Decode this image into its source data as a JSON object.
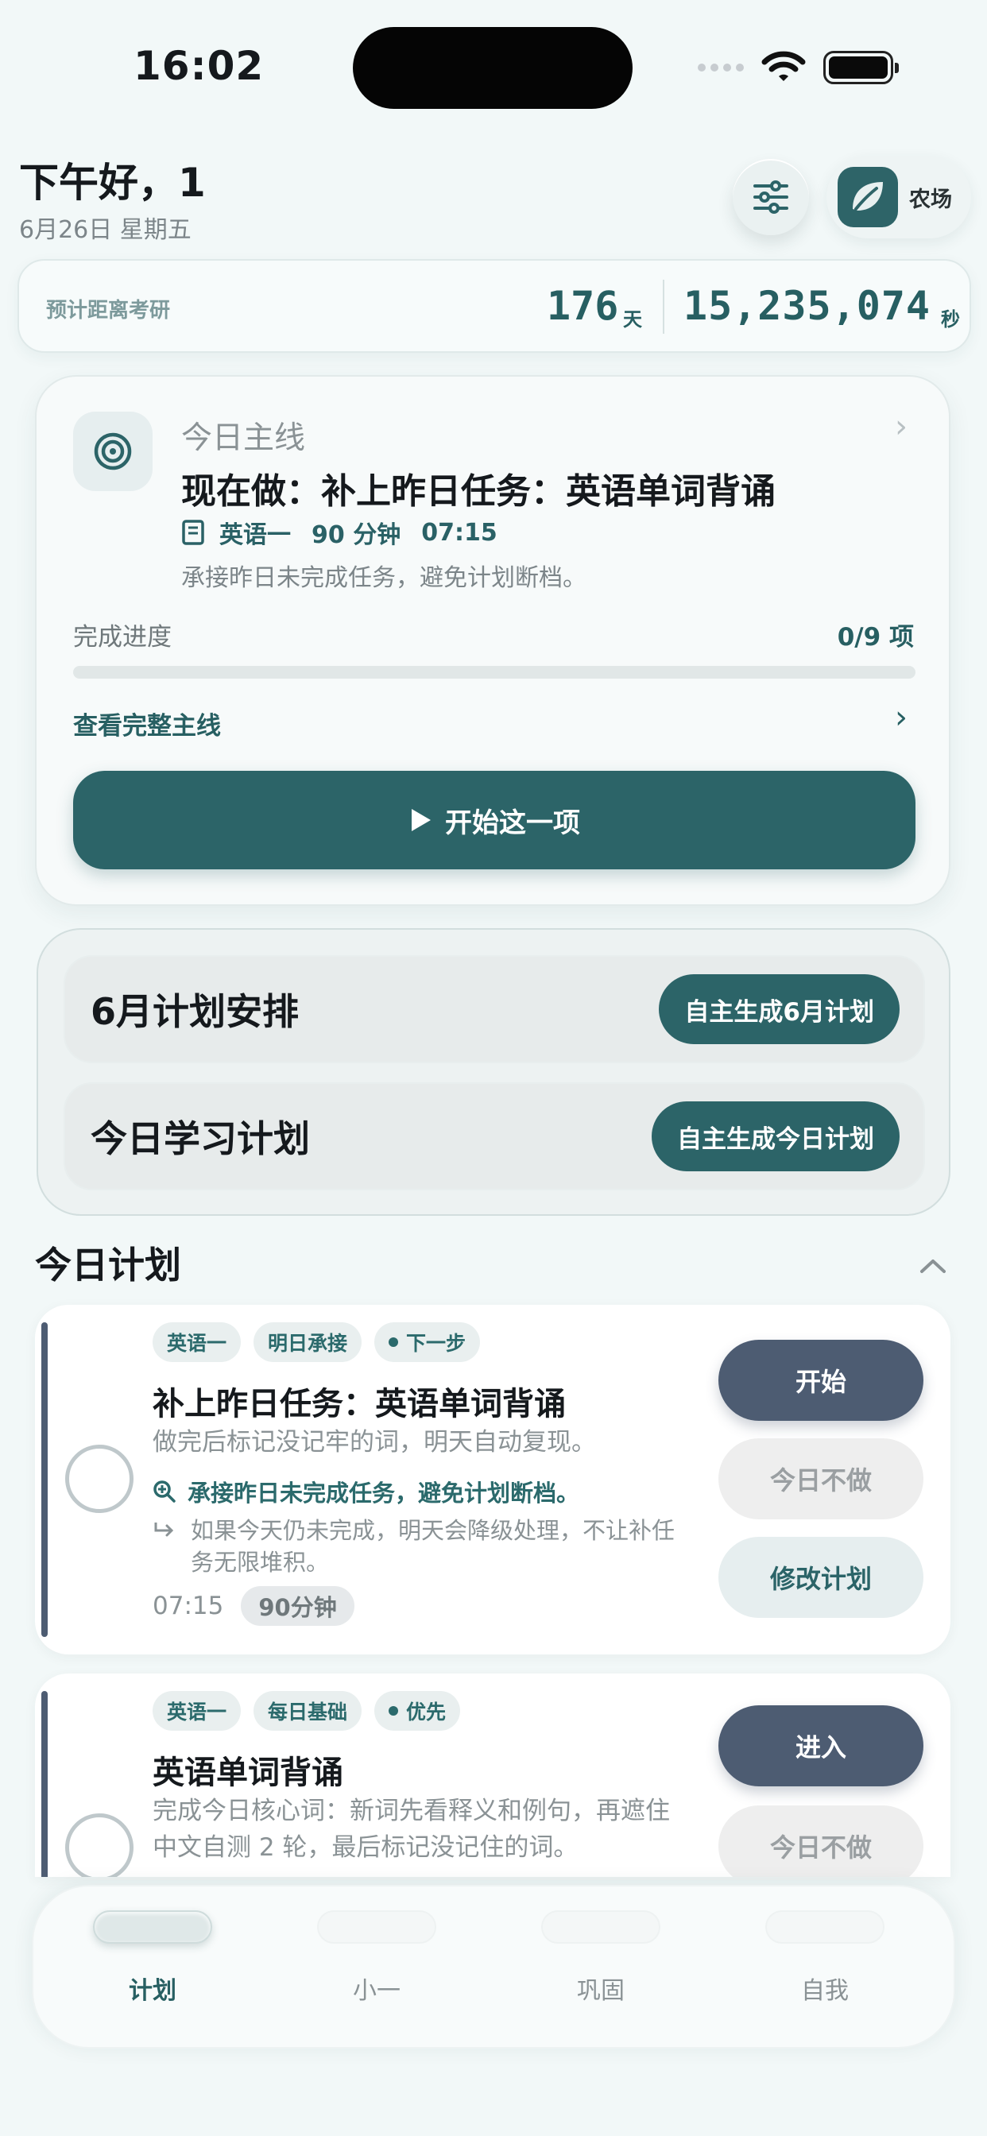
{
  "status": {
    "time": "16:02"
  },
  "header": {
    "greeting": "下午好，1",
    "date": "6月26日 星期五",
    "farm_label": "农场",
    "filter_icon": "sliders-icon",
    "farm_icon": "leaf-icon"
  },
  "countdown": {
    "label": "预计距离考研",
    "days": "176",
    "days_unit": "天",
    "seconds": "15,235,074",
    "seconds_unit": "秒"
  },
  "main": {
    "overline": "今日主线",
    "title": "现在做：补上昨日任务：英语单词背诵",
    "subject": "英语一",
    "duration": "90 分钟",
    "time": "07:15",
    "note": "承接昨日未完成任务，避免计划断档。",
    "progress_label": "完成进度",
    "progress_count": "0/9 项",
    "progress_fraction": 0,
    "view_all": "查看完整主线",
    "start_label": "开始这一项"
  },
  "plan": {
    "rows": [
      {
        "title": "6月计划安排",
        "button": "自主生成6月计划"
      },
      {
        "title": "今日学习计划",
        "button": "自主生成今日计划"
      }
    ]
  },
  "section": {
    "title": "今日计划"
  },
  "tasks": [
    {
      "chips": [
        "英语一",
        "明日承接",
        "下一步"
      ],
      "title": "补上昨日任务：英语单词背诵",
      "desc": "做完后标记没记牢的词，明天自动复现。",
      "carry": "承接昨日未完成任务，避免计划断档。",
      "warn": "如果今天仍未完成，明天会降级处理，不让补任务无限堆积。",
      "time": "07:15",
      "duration": "90分钟",
      "actions": [
        "开始",
        "今日不做",
        "修改计划"
      ]
    },
    {
      "chips": [
        "英语一",
        "每日基础",
        "优先"
      ],
      "title": "英语单词背诵",
      "desc": "完成今日核心词：新词先看释义和例句，再遮住中文自测 2 轮，最后标记没记住的词。",
      "actions": [
        "进入",
        "今日不做"
      ]
    }
  ],
  "tabbar": {
    "tabs": [
      {
        "label": "计划",
        "active": true
      },
      {
        "label": "小一",
        "active": false
      },
      {
        "label": "巩固",
        "active": false
      },
      {
        "label": "自我",
        "active": false
      }
    ]
  },
  "colors": {
    "accent": "#2c6468",
    "task_primary": "#4d5c72",
    "background": "#f2f8f8"
  }
}
